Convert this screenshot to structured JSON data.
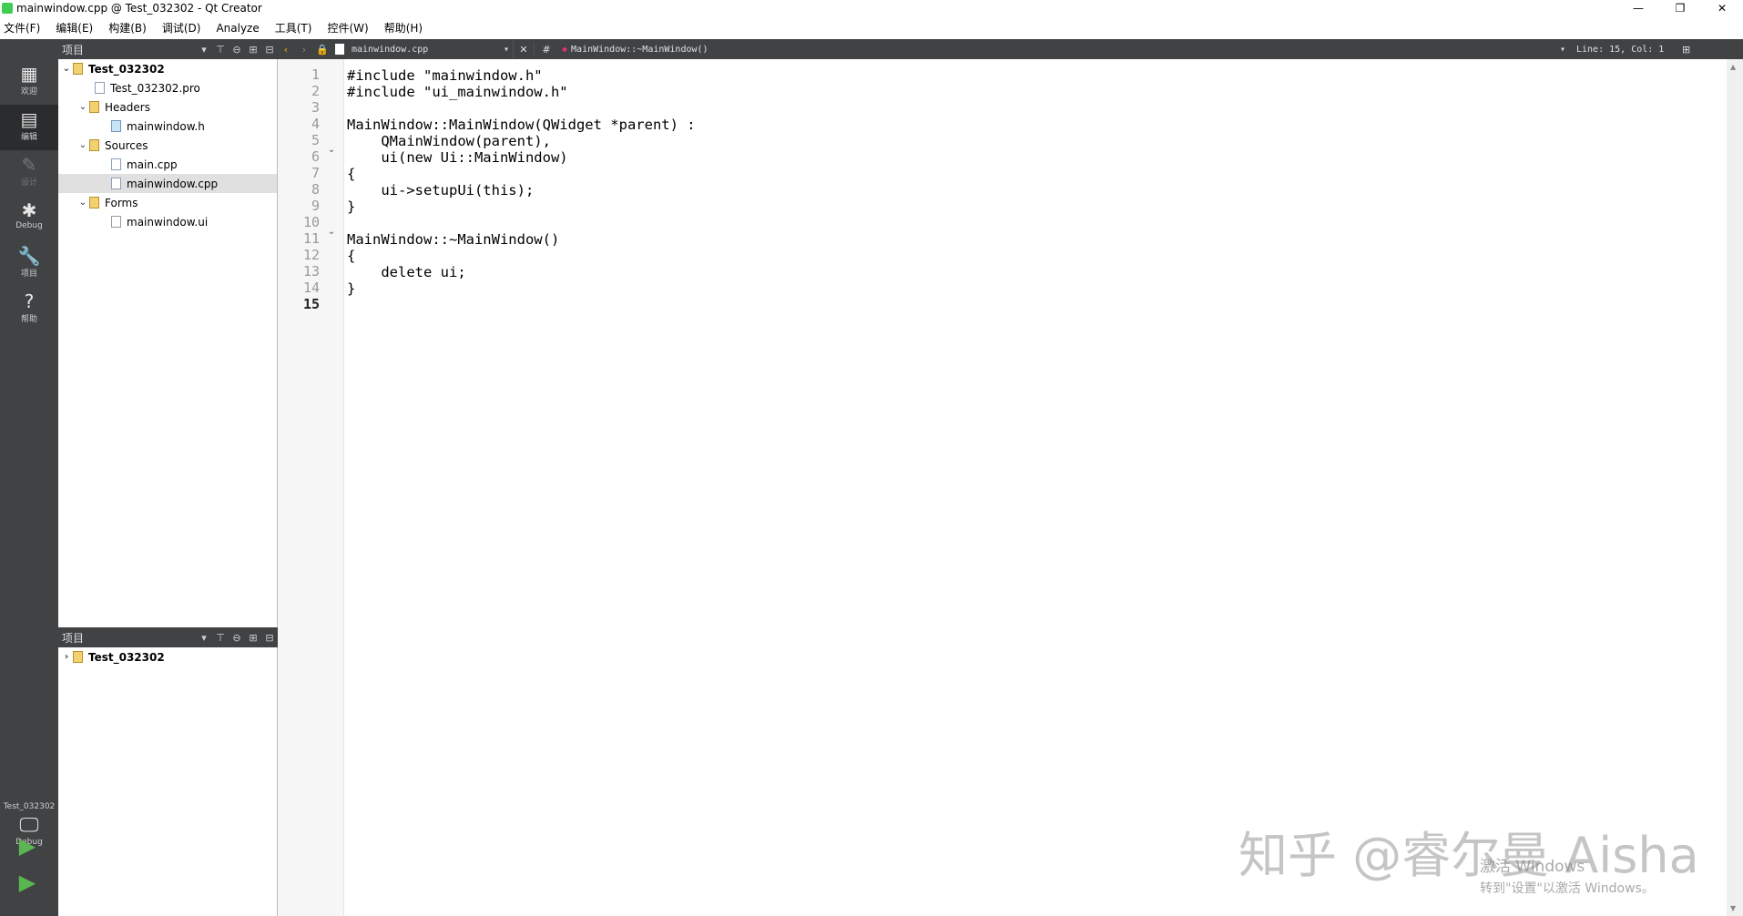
{
  "window": {
    "title": "mainwindow.cpp @ Test_032302 - Qt Creator",
    "controls": {
      "minimize": "—",
      "restore": "❐",
      "close": "✕"
    }
  },
  "menubar": {
    "items": [
      "文件(F)",
      "编辑(E)",
      "构建(B)",
      "调试(D)",
      "Analyze",
      "工具(T)",
      "控件(W)",
      "帮助(H)"
    ]
  },
  "modes": {
    "items": [
      {
        "label": "欢迎",
        "icon": "grid-icon"
      },
      {
        "label": "编辑",
        "icon": "edit-icon",
        "active": true
      },
      {
        "label": "设计",
        "icon": "pencil-icon",
        "disabled": true
      },
      {
        "label": "Debug",
        "icon": "bug-icon"
      },
      {
        "label": "项目",
        "icon": "wrench-icon"
      },
      {
        "label": "帮助",
        "icon": "help-icon"
      }
    ],
    "kit": {
      "project": "Test_032302",
      "mode": "Debug"
    }
  },
  "project_pane_top": {
    "title": "项目",
    "tree": [
      {
        "label": "Test_032302",
        "type": "project",
        "expanded": true
      },
      {
        "label": "Test_032302.pro",
        "type": "file"
      },
      {
        "label": "Headers",
        "type": "folder",
        "expanded": true
      },
      {
        "label": "mainwindow.h",
        "type": "header"
      },
      {
        "label": "Sources",
        "type": "folder",
        "expanded": true
      },
      {
        "label": "main.cpp",
        "type": "source"
      },
      {
        "label": "mainwindow.cpp",
        "type": "source",
        "selected": true
      },
      {
        "label": "Forms",
        "type": "folder",
        "expanded": true
      },
      {
        "label": "mainwindow.ui",
        "type": "ui"
      }
    ]
  },
  "project_pane_bottom": {
    "title": "项目",
    "tree": [
      {
        "label": "Test_032302",
        "type": "project",
        "expanded": false
      }
    ]
  },
  "editor": {
    "file_combo": "mainwindow.cpp",
    "hash": "#",
    "symbol_combo": "MainWindow::~MainWindow()",
    "position": "Line: 15, Col: 1",
    "current_line": 15,
    "lines": [
      "#include \"mainwindow.h\"",
      "#include \"ui_mainwindow.h\"",
      "",
      "MainWindow::MainWindow(QWidget *parent) :",
      "    QMainWindow(parent),",
      "    ui(new Ui::MainWindow)",
      "{",
      "    ui->setupUi(this);",
      "}",
      "",
      "MainWindow::~MainWindow()",
      "{",
      "    delete ui;",
      "}",
      ""
    ]
  },
  "overlay": {
    "watermark": "知乎 @睿尔曼 Aisha",
    "activate_line1": "激活 Windows",
    "activate_line2": "转到\"设置\"以激活 Windows。"
  },
  "colors": {
    "sidebar": "#404244",
    "toolbar": "#404244",
    "keyword": "#808000",
    "type": "#800080",
    "string": "#008000"
  }
}
